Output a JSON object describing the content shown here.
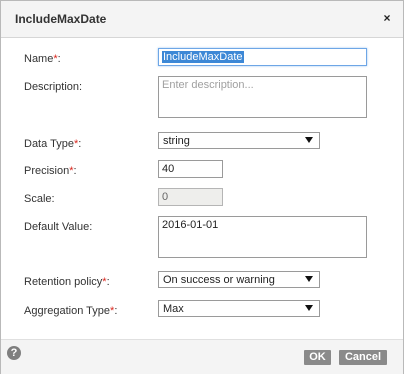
{
  "dialog": {
    "title": "IncludeMaxDate",
    "close_glyph": "×"
  },
  "form": {
    "name_label": "Name",
    "name_value": "IncludeMaxDate",
    "description_label": "Description:",
    "description_placeholder": "Enter description...",
    "datatype_label": "Data Type",
    "datatype_value": "string",
    "precision_label": "Precision",
    "precision_value": "40",
    "scale_label": "Scale:",
    "scale_value": "0",
    "default_label": "Default Value:",
    "default_value": "2016-01-01",
    "retention_label": "Retention policy",
    "retention_value": "On success or warning",
    "aggregation_label": "Aggregation Type",
    "aggregation_value": "Max",
    "required_mark": "*",
    "colon": ":"
  },
  "footer": {
    "help_glyph": "?",
    "ok_label": "OK",
    "cancel_label": "Cancel"
  },
  "colors": {
    "required": "#d9261c",
    "button_bg": "#8a8a8a",
    "selection": "#3d88d6"
  },
  "icons": [
    "close-icon",
    "help-icon",
    "dropdown-arrow-icon"
  ]
}
